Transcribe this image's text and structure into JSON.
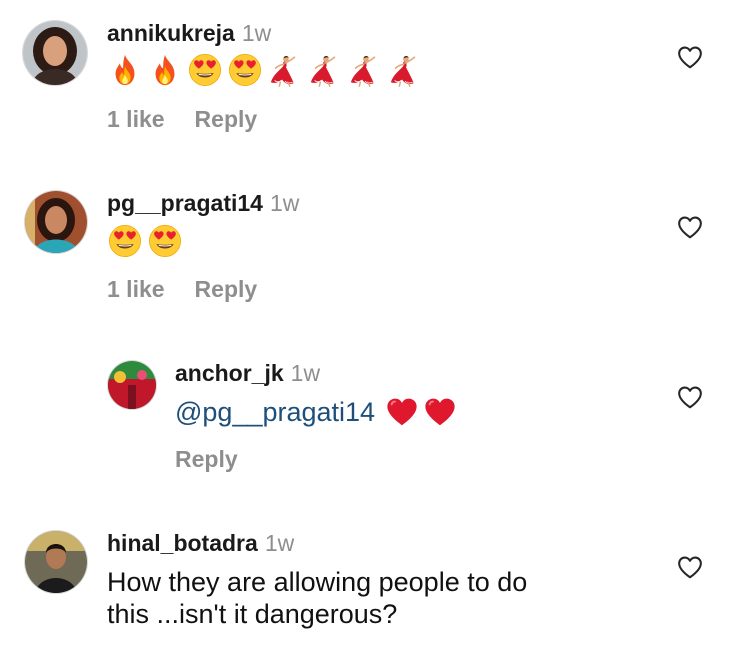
{
  "colors": {
    "username": "#1a1a1a",
    "time": "#8e8e8e",
    "actions": "#8e8e8e",
    "mention": "#1e4f7a",
    "heart_red": "#e0182d"
  },
  "comments": [
    {
      "username": "annikukreja",
      "time": "1w",
      "emojis": [
        "fire-emoji",
        "fire-emoji",
        "heart-eyes-emoji",
        "heart-eyes-emoji",
        "dancer-emoji",
        "dancer-emoji",
        "dancer-emoji",
        "dancer-emoji"
      ],
      "likes": "1 like",
      "reply": "Reply",
      "like_icon": "heart-outline-icon"
    },
    {
      "username": "pg__pragati14",
      "time": "1w",
      "emojis": [
        "heart-eyes-emoji",
        "heart-eyes-emoji"
      ],
      "likes": "1 like",
      "reply": "Reply",
      "like_icon": "heart-outline-icon"
    },
    {
      "username": "anchor_jk",
      "time": "1w",
      "mention": "@pg__pragati14",
      "emojis": [
        "red-heart-emoji",
        "red-heart-emoji"
      ],
      "reply": "Reply",
      "like_icon": "heart-outline-icon"
    },
    {
      "username": "hinal_botadra",
      "time": "1w",
      "text_line1": "How they are allowing people to do",
      "text_line2": "this ...isn't it dangerous?",
      "like_icon": "heart-outline-icon"
    }
  ]
}
